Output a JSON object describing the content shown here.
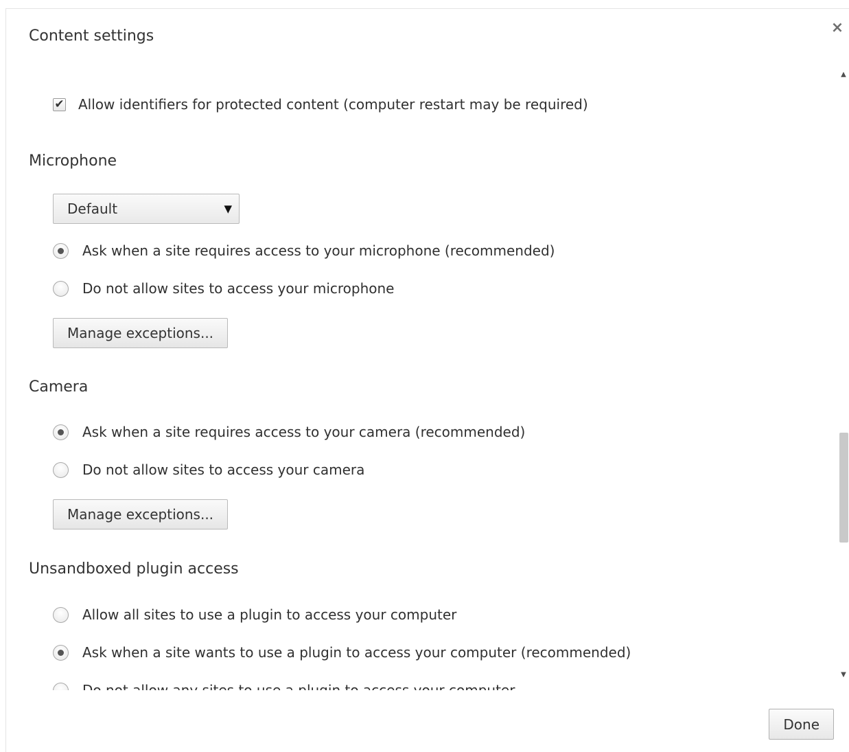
{
  "dialog": {
    "title": "Content settings",
    "close_glyph": "×",
    "done_label": "Done"
  },
  "protected_content": {
    "checkbox_label": "Allow identifiers for protected content (computer restart may be required)",
    "checked": true,
    "check_glyph": "✔"
  },
  "microphone": {
    "heading": "Microphone",
    "device_select": "Default",
    "caret_glyph": "▼",
    "options": [
      {
        "label": "Ask when a site requires access to your microphone (recommended)",
        "selected": true
      },
      {
        "label": "Do not allow sites to access your microphone",
        "selected": false
      }
    ],
    "manage_label": "Manage exceptions..."
  },
  "camera": {
    "heading": "Camera",
    "options": [
      {
        "label": "Ask when a site requires access to your camera (recommended)",
        "selected": true
      },
      {
        "label": "Do not allow sites to access your camera",
        "selected": false
      }
    ],
    "manage_label": "Manage exceptions..."
  },
  "unsandboxed": {
    "heading": "Unsandboxed plugin access",
    "options": [
      {
        "label": "Allow all sites to use a plugin to access your computer",
        "selected": false
      },
      {
        "label": "Ask when a site wants to use a plugin to access your computer (recommended)",
        "selected": true
      },
      {
        "label": "Do not allow any sites to use a plugin to access your computer",
        "selected": false
      }
    ]
  },
  "scrollbar": {
    "up_glyph": "▲",
    "down_glyph": "▼",
    "position_fraction": 0.62
  }
}
